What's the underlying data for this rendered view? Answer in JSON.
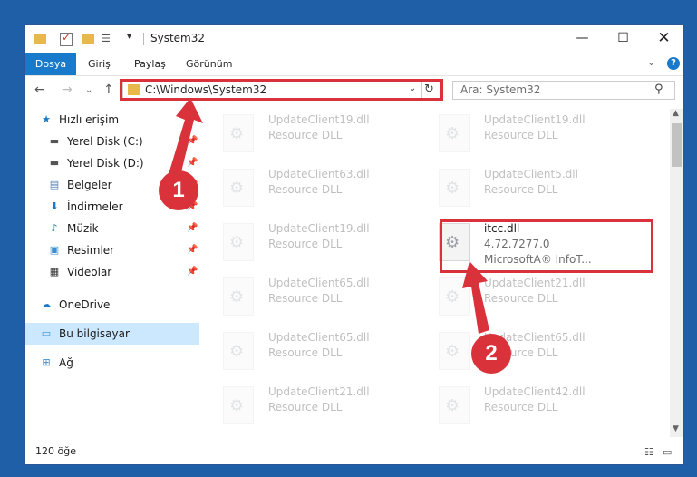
{
  "window": {
    "title": "System32",
    "minimize": "—",
    "maximize": "☐",
    "close": "✕"
  },
  "ribbon": {
    "tabs": [
      "Dosya",
      "Giriş",
      "Paylaş",
      "Görünüm"
    ],
    "help": "?"
  },
  "nav": {
    "address": "C:\\Windows\\System32",
    "search_placeholder": "Ara: System32"
  },
  "sidebar": {
    "items": [
      {
        "label": "Hızlı erişim",
        "icon": "star-icon"
      },
      {
        "label": "Yerel Disk (C:)",
        "icon": "drive-icon",
        "pinned": true
      },
      {
        "label": "Yerel Disk (D:)",
        "icon": "drive-icon",
        "pinned": true
      },
      {
        "label": "Belgeler",
        "icon": "document-icon",
        "pinned": true
      },
      {
        "label": "İndirmeler",
        "icon": "download-icon",
        "pinned": true
      },
      {
        "label": "Müzik",
        "icon": "music-icon",
        "pinned": true
      },
      {
        "label": "Resimler",
        "icon": "pictures-icon",
        "pinned": true
      },
      {
        "label": "Videolar",
        "icon": "video-icon",
        "pinned": true
      },
      {
        "label": "OneDrive",
        "icon": "cloud-icon"
      },
      {
        "label": "Bu bilgisayar",
        "icon": "computer-icon",
        "selected": true
      },
      {
        "label": "Ağ",
        "icon": "network-icon"
      }
    ]
  },
  "files": [
    {
      "name": "UpdateClient19.dll",
      "desc": "Resource DLL",
      "faded": true
    },
    {
      "name": "UpdateClient19.dll",
      "desc": "Resource DLL",
      "faded": true
    },
    {
      "name": "UpdateClient63.dll",
      "desc": "Resource DLL",
      "faded": true
    },
    {
      "name": "UpdateClient5.dll",
      "desc": "Resource DLL",
      "faded": true
    },
    {
      "name": "UpdateClient19.dll",
      "desc": "Resource DLL",
      "faded": true
    },
    {
      "name": "itcc.dll",
      "version": "4.72.7277.0",
      "desc": "MicrosoftA® InfoT...",
      "faded": false
    },
    {
      "name": "UpdateClient65.dll",
      "desc": "Resource DLL",
      "faded": true
    },
    {
      "name": "UpdateClient21.dll",
      "desc": "Resource DLL",
      "faded": true
    },
    {
      "name": "UpdateClient65.dll",
      "desc": "Resource DLL",
      "faded": true
    },
    {
      "name": "UpdateClient65.dll",
      "desc": "Resource DLL",
      "faded": true
    },
    {
      "name": "UpdateClient21.dll",
      "desc": "Resource DLL",
      "faded": true
    },
    {
      "name": "UpdateClient42.dll",
      "desc": "Resource DLL",
      "faded": true
    }
  ],
  "status": {
    "count": "120 öğe"
  },
  "callouts": [
    "1",
    "2"
  ],
  "colors": {
    "accent": "#1979ca",
    "highlight": "#d9323b",
    "desktop": "#1f5fa8"
  }
}
